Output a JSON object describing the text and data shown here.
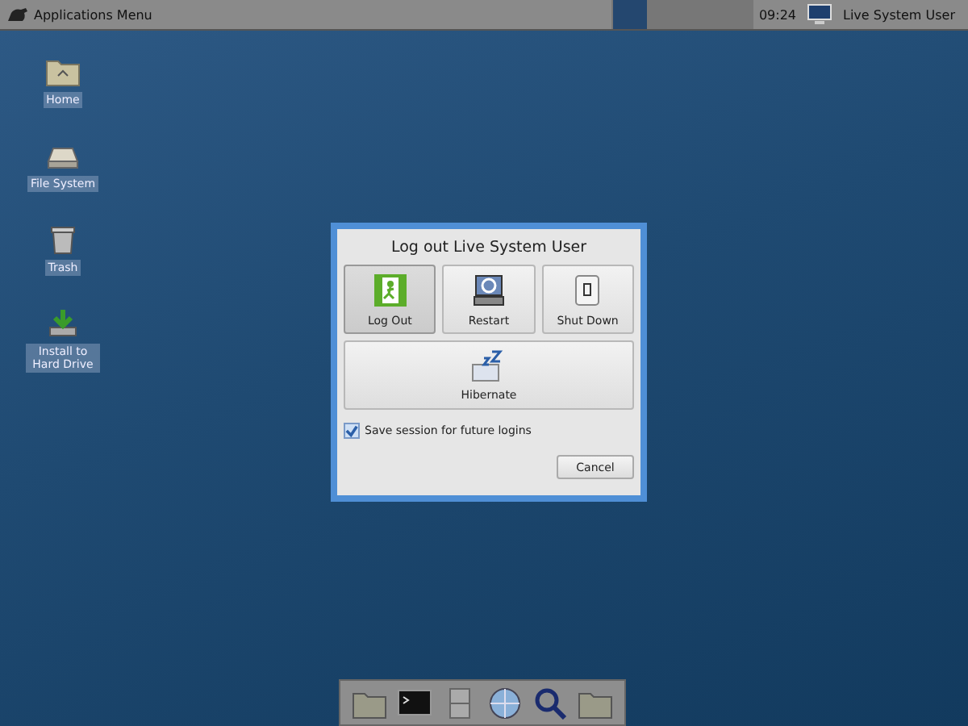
{
  "panel": {
    "menu_label": "Applications Menu",
    "workspaces": [
      {
        "selected": true
      },
      {
        "selected": false
      },
      {
        "selected": false
      },
      {
        "selected": false
      }
    ],
    "clock": "09:24",
    "user": "Live System User"
  },
  "desktop_items": [
    {
      "kind": "home",
      "label": "Home"
    },
    {
      "kind": "drive",
      "label": "File System"
    },
    {
      "kind": "trash",
      "label": "Trash"
    },
    {
      "kind": "install",
      "label": "Install to Hard Drive"
    }
  ],
  "dialog": {
    "title": "Log out Live System User",
    "actions": [
      {
        "kind": "logout",
        "label": "Log Out",
        "focused": true
      },
      {
        "kind": "restart",
        "label": "Restart",
        "focused": false
      },
      {
        "kind": "shutdown",
        "label": "Shut Down",
        "focused": false
      }
    ],
    "hibernate": {
      "label": "Hibernate"
    },
    "save_session": {
      "label": "Save session for future logins",
      "checked": true
    },
    "cancel": "Cancel"
  },
  "dock": [
    {
      "kind": "folder"
    },
    {
      "kind": "terminal"
    },
    {
      "kind": "cabinet"
    },
    {
      "kind": "globe"
    },
    {
      "kind": "search"
    },
    {
      "kind": "folder"
    }
  ]
}
